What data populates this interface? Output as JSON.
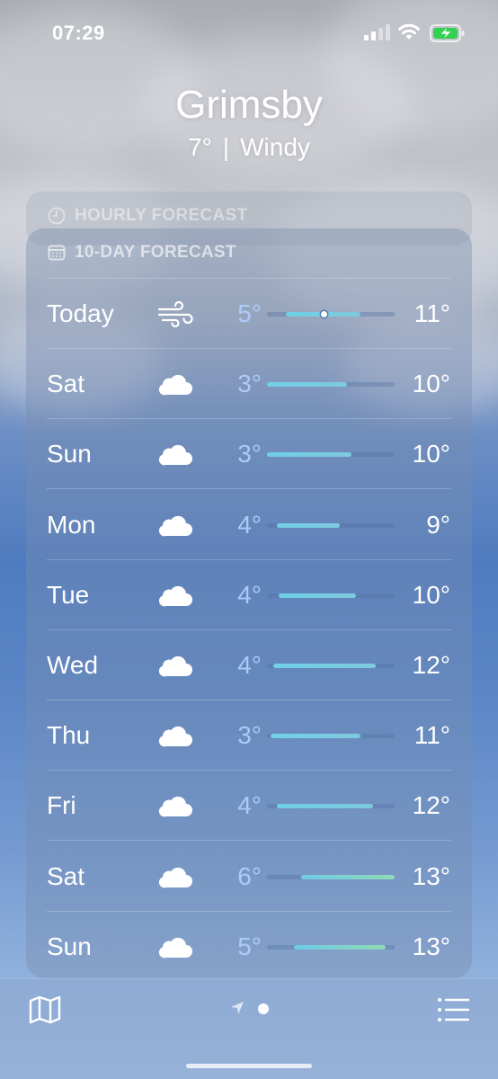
{
  "status_bar": {
    "time": "07:29",
    "icons": [
      "cellular-signal-icon",
      "wifi-icon",
      "battery-charging-icon"
    ],
    "battery_color": "#33d14f"
  },
  "header": {
    "city": "Grimsby",
    "temperature": "7°",
    "separator": "|",
    "condition": "Windy"
  },
  "hourly_forecast": {
    "title": "HOURLY FORECAST",
    "icon": "clock-icon"
  },
  "ten_day_forecast": {
    "title": "10-DAY FORECAST",
    "icon": "calendar-icon",
    "days": [
      {
        "day": "Today",
        "icon": "wind-icon",
        "low": "5°",
        "high": "11°",
        "range_start": 0.15,
        "range_end": 0.73,
        "current": 0.45
      },
      {
        "day": "Sat",
        "icon": "cloud-icon",
        "low": "3°",
        "high": "10°",
        "range_start": 0.0,
        "range_end": 0.63
      },
      {
        "day": "Sun",
        "icon": "cloud-icon",
        "low": "3°",
        "high": "10°",
        "range_start": 0.0,
        "range_end": 0.66
      },
      {
        "day": "Mon",
        "icon": "cloud-icon",
        "low": "4°",
        "high": "9°",
        "range_start": 0.08,
        "range_end": 0.57
      },
      {
        "day": "Tue",
        "icon": "cloud-icon",
        "low": "4°",
        "high": "10°",
        "range_start": 0.09,
        "range_end": 0.7
      },
      {
        "day": "Wed",
        "icon": "cloud-icon",
        "low": "4°",
        "high": "12°",
        "range_start": 0.05,
        "range_end": 0.85
      },
      {
        "day": "Thu",
        "icon": "cloud-icon",
        "low": "3°",
        "high": "11°",
        "range_start": 0.03,
        "range_end": 0.73
      },
      {
        "day": "Fri",
        "icon": "cloud-icon",
        "low": "4°",
        "high": "12°",
        "range_start": 0.08,
        "range_end": 0.83
      },
      {
        "day": "Sat",
        "icon": "cloud-icon",
        "low": "6°",
        "high": "13°",
        "range_start": 0.27,
        "range_end": 1.0,
        "warm": true
      },
      {
        "day": "Sun",
        "icon": "cloud-icon",
        "low": "5°",
        "high": "13°",
        "range_start": 0.21,
        "range_end": 0.93,
        "warm": true
      }
    ]
  },
  "bottom_bar": {
    "left_icon": "map-icon",
    "center_icons": [
      "location-arrow-icon",
      "page-dot"
    ],
    "right_icon": "list-icon"
  }
}
